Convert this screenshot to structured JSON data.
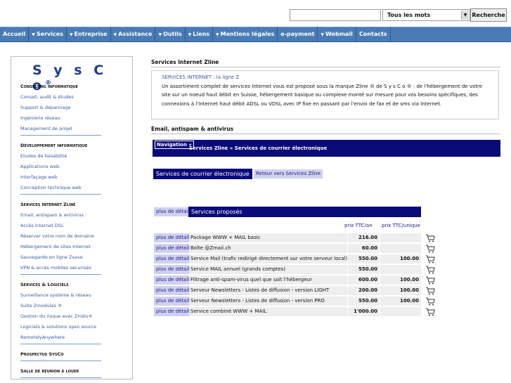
{
  "search": {
    "placeholder": "",
    "mode": "Tous les mots",
    "button": "Recherche"
  },
  "nav": [
    {
      "label": "Accueil",
      "dropdown": false
    },
    {
      "label": "Services",
      "dropdown": true
    },
    {
      "label": "Entreprise",
      "dropdown": true
    },
    {
      "label": "Assistance",
      "dropdown": true
    },
    {
      "label": "Outils",
      "dropdown": true
    },
    {
      "label": "Liens",
      "dropdown": true
    },
    {
      "label": "Mentions légales",
      "dropdown": true
    },
    {
      "label": "e-payment",
      "dropdown": false
    },
    {
      "label": "Webmail",
      "dropdown": true
    },
    {
      "label": "Contacts",
      "dropdown": false
    }
  ],
  "sidebar": {
    "logo": "SysCo",
    "logo_mark": "®",
    "sections": [
      {
        "title": "Consulting informatique",
        "links": [
          "Conseil, audit & études",
          "Support & dépannage",
          "Ingénierie réseau",
          "Management de projet"
        ]
      },
      {
        "title": "Développement informatique",
        "links": [
          "Etudes de faisabilité",
          "Applications web",
          "Interfaçage web",
          "Conception technique web"
        ]
      },
      {
        "title": "Services Internet Zline",
        "links": [
          "Email, antispam & antivirus",
          "Accès Internet DSL",
          "Réserver votre nom de domaine",
          "Hébergement de sites Internet",
          "Sauvegarde en ligne Zsave",
          "VPN & accès mobiles sécurisés"
        ]
      },
      {
        "title": "Services & Logiciels",
        "links": [
          "Surveillance système & réseau",
          "Suite Zmodules ®",
          "Gestion du risque avec Zrisks®",
          "Logiciels & solutions open source",
          "RemotelyAnywhere"
        ]
      },
      {
        "title": "Prospectus SysCo",
        "links": []
      },
      {
        "title": "Salle de réunion à louer",
        "links": []
      }
    ]
  },
  "main": {
    "section1_title": "Services Internet Zline",
    "intro_head": "SERVICES INTERNET : la ligne Z",
    "intro_lines": [
      "Un assortiment complet de services Internet vous est proposé sous la marque Zline ® de S y s C o ® : de l'hébergement de votre",
      "site sur un noeud haut débit en Suisse, hébergement basique ou complexe monté sur mesure pour vos besoins spécifiques, des",
      "connexions à l'Internet haut débit ADSL ou VDSL avec IP fixe en passant par l'envoi de fax et de sms via Internet."
    ],
    "section2_title": "Email, antispam & antivirus",
    "navigation_label": "Navigation »",
    "navigation_path": "Services Zline » Services de courrier électronique",
    "sc_title": "Services de courrier électronique",
    "sc_back": "Retour vers Services Zline",
    "table": {
      "detail_label": "plus de détail",
      "title": "Services proposés",
      "col_year": "prix TTC/an",
      "col_unit": "prix TTC/unique",
      "rows": [
        {
          "desc": "Package WWW + MAIL basic",
          "year": "216.00",
          "unit": ""
        },
        {
          "desc": "Boîte @Zmail.ch",
          "year": "60.00",
          "unit": ""
        },
        {
          "desc": "Service Mail (trafic redirigé directement sur votre serveur local)",
          "year": "550.00",
          "unit": "100.00"
        },
        {
          "desc": "Service MAIL annuel (grands comptes)",
          "year": "550.00",
          "unit": ""
        },
        {
          "desc": "Filtrage anti-spam-virus quel que soit l'hébergeur",
          "year": "600.00",
          "unit": "100.00"
        },
        {
          "desc": "Serveur Newsletters - Listes de diffusion - version LIGHT",
          "year": "200.00",
          "unit": "100.00"
        },
        {
          "desc": "Serveur Newsletters - Listes de diffusion - version PRO",
          "year": "550.00",
          "unit": "100.00"
        },
        {
          "desc": "Service combiné WWW + MAIL",
          "year": "1'000.00",
          "unit": ""
        }
      ]
    }
  },
  "icons": {
    "cart": "shopping-cart-icon",
    "dropdown": "chevron-down-icon"
  }
}
